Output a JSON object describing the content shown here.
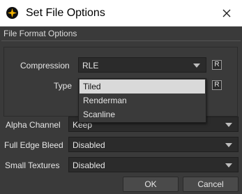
{
  "window": {
    "title": "Set File Options"
  },
  "section": {
    "title": "File Format Options"
  },
  "compression": {
    "label": "Compression",
    "value": "RLE",
    "reset_label": "R"
  },
  "type": {
    "label": "Type",
    "reset_label": "R",
    "options": [
      "Tiled",
      "Renderman",
      "Scanline"
    ],
    "selected": "Tiled"
  },
  "alpha_channel": {
    "label": "Alpha Channel",
    "value": "Keep"
  },
  "full_edge_bleed": {
    "label": "Full Edge Bleed",
    "value": "Disabled"
  },
  "small_textures": {
    "label": "Small Textures",
    "value": "Disabled"
  },
  "buttons": {
    "ok": "OK",
    "cancel": "Cancel"
  },
  "colors": {
    "background": "#3a3a3a",
    "field": "#2b2b2b",
    "highlight": "#d9d9d9",
    "text": "#e6e6e6"
  },
  "icons": {
    "app": "app-logo-icon",
    "close": "close-icon",
    "dropdown": "chevron-down-icon"
  }
}
